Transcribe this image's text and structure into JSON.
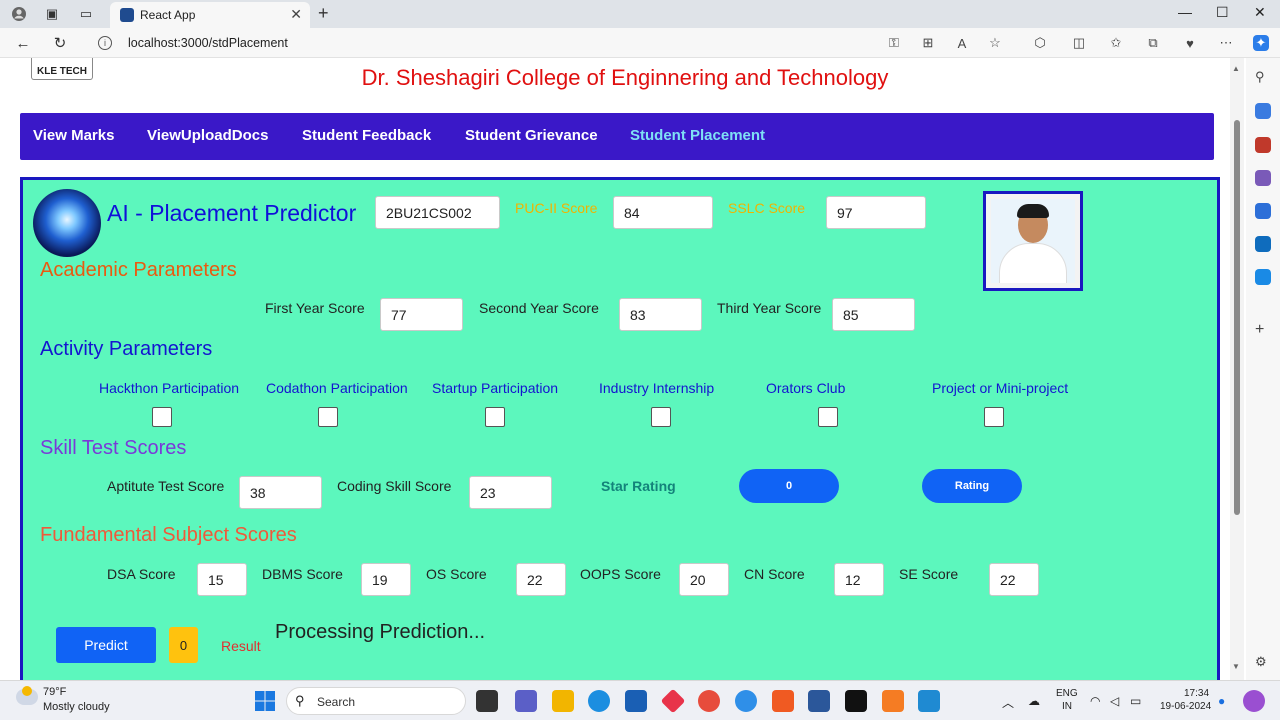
{
  "browser": {
    "tab_title": "React App",
    "url": "localhost:3000/stdPlacement"
  },
  "page": {
    "logo_text": "KLE TECH",
    "college_name": "Dr. Sheshagiri College of Enginnering and Technology",
    "nav": [
      "View Marks",
      "ViewUploadDocs",
      "Student Feedback",
      "Student Grievance",
      "Student Placement"
    ],
    "active_nav": "Student Placement",
    "title": "AI - Placement Predictor",
    "usn_value": "2BU21CS002",
    "puc_label": "PUC-II Score",
    "puc_value": "84",
    "sslc_label": "SSLC Score",
    "sslc_value": "97",
    "academic_title": "Academic Parameters",
    "first_label": "First Year Score",
    "first_value": "77",
    "second_label": "Second Year Score",
    "second_value": "83",
    "third_label": "Third Year Score",
    "third_value": "85",
    "activity_title": "Activity Parameters",
    "activities": [
      "Hackthon Participation",
      "Codathon Participation",
      "Startup Participation",
      "Industry Internship",
      "Orators Club",
      "Project or Mini-project"
    ],
    "skill_title": "Skill Test Scores",
    "aptitude_label": "Aptitute Test Score",
    "aptitude_value": "38",
    "coding_label": "Coding Skill Score",
    "coding_value": "23",
    "star_label": "Star Rating",
    "star_value": "0",
    "rating_button": "Rating",
    "fund_title": "Fundamental Subject Scores",
    "subjects": [
      {
        "label": "DSA Score",
        "value": "15"
      },
      {
        "label": "DBMS Score",
        "value": "19"
      },
      {
        "label": "OS Score",
        "value": "22"
      },
      {
        "label": "OOPS Score",
        "value": "20"
      },
      {
        "label": "CN Score",
        "value": "12"
      },
      {
        "label": "SE Score",
        "value": "22"
      }
    ],
    "predict_button": "Predict",
    "result_value": "0",
    "result_label": "Result",
    "processing": "Processing Prediction..."
  },
  "taskbar": {
    "temp": "79°F",
    "weather": "Mostly cloudy",
    "search": "Search",
    "lang1": "ENG",
    "lang2": "IN",
    "time": "17:34",
    "date": "19-06-2024"
  },
  "colors": {
    "nav_bg": "#3a18c8",
    "panel_bg": "#5cf7bd",
    "accent_blue": "#1063f5",
    "heading_red": "#e01010"
  }
}
